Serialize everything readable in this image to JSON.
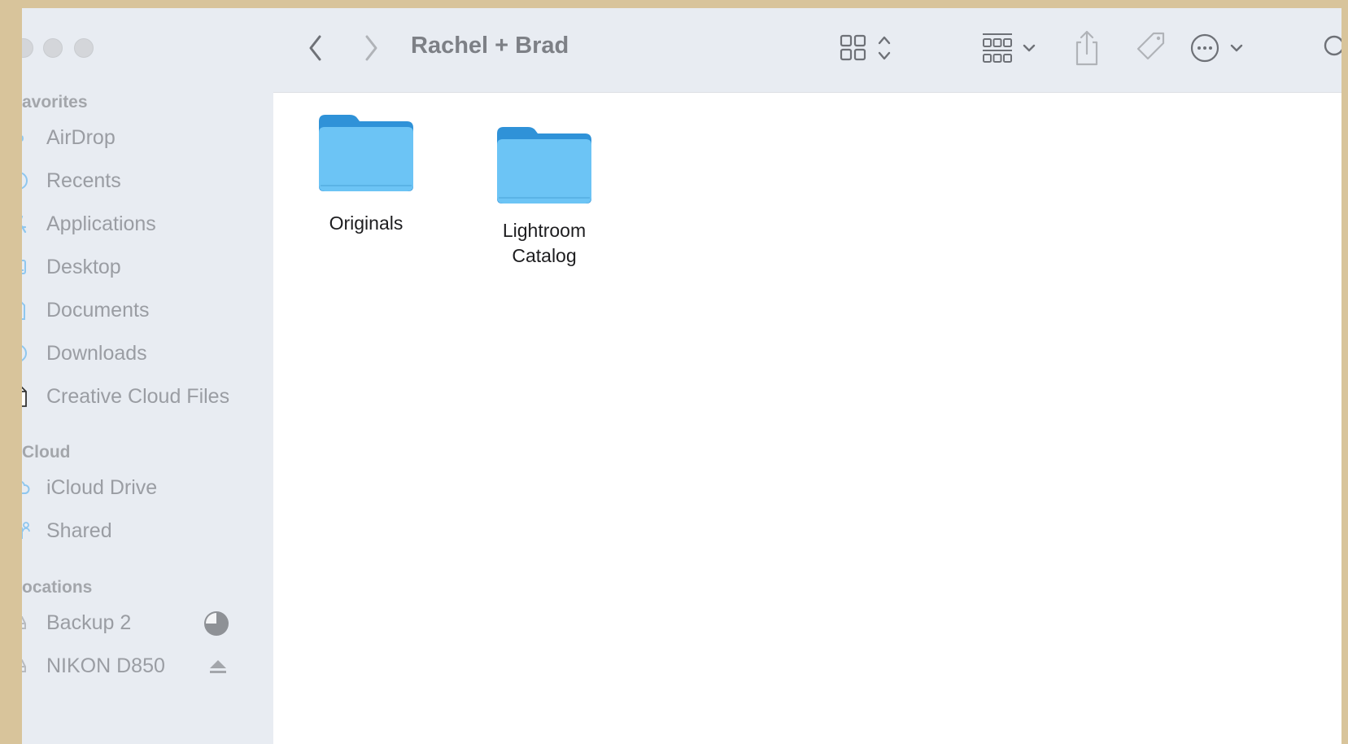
{
  "window": {
    "title": "Rachel + Brad"
  },
  "sidebar": {
    "sections": {
      "favorites": "avorites",
      "icloud": "Cloud",
      "locations": "ocations"
    },
    "favorites": [
      {
        "label": "AirDrop",
        "icon": "airdrop-icon"
      },
      {
        "label": "Recents",
        "icon": "clock-icon"
      },
      {
        "label": "Applications",
        "icon": "applications-icon"
      },
      {
        "label": "Desktop",
        "icon": "desktop-icon"
      },
      {
        "label": "Documents",
        "icon": "document-icon"
      },
      {
        "label": "Downloads",
        "icon": "download-icon"
      },
      {
        "label": "Creative Cloud Files",
        "icon": "file-icon"
      }
    ],
    "icloud": [
      {
        "label": "iCloud Drive",
        "icon": "cloud-icon"
      },
      {
        "label": "Shared",
        "icon": "shared-folder-icon"
      }
    ],
    "locations": [
      {
        "label": "Backup 2",
        "icon": "drive-icon",
        "right_icon": "disk-usage-pie-icon"
      },
      {
        "label": "NIKON D850",
        "icon": "drive-icon",
        "right_icon": "eject-icon"
      }
    ]
  },
  "toolbar": {
    "back": "chevron-left-icon",
    "forward": "chevron-right-icon",
    "view": "icon-grid-view-icon",
    "group": "group-by-icon",
    "share": "share-icon",
    "tag": "tag-icon",
    "more": "more-actions-icon",
    "search": "search-icon"
  },
  "files": [
    {
      "name": "Originals"
    },
    {
      "name": "Lightroom\nCatalog"
    }
  ],
  "colors": {
    "accent": "#3d9ee8",
    "folder_front": "#6cc4f5",
    "folder_back": "#2f92d8",
    "sidebar_bg": "#e8ecf2",
    "desktop_bg": "#d8c49b"
  }
}
